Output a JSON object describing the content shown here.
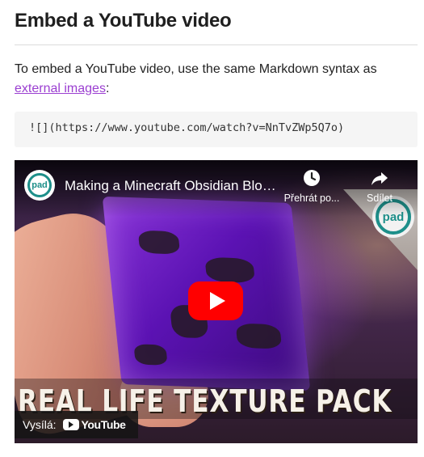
{
  "heading": "Embed a YouTube video",
  "paragraph": {
    "before": "To embed a YouTube video, use the same Markdown syntax as ",
    "link": "external images",
    "after": ":"
  },
  "code": "![](https://www.youtube.com/watch?v=NnTvZWp5Q7o)",
  "video": {
    "channel_avatar_text": "pad",
    "title": "Making a Minecraft Obsidian Block in Real Life...",
    "watch_later_label": "Přehrát po...",
    "share_label": "Sdílet",
    "thumbnail_text": "REAL LIFE TEXTURE PACK",
    "broadcast_label": "Vysílá:",
    "youtube_logo_text": "YouTube"
  },
  "colors": {
    "link": "#9b3fd1",
    "play_button": "#ff0000"
  }
}
